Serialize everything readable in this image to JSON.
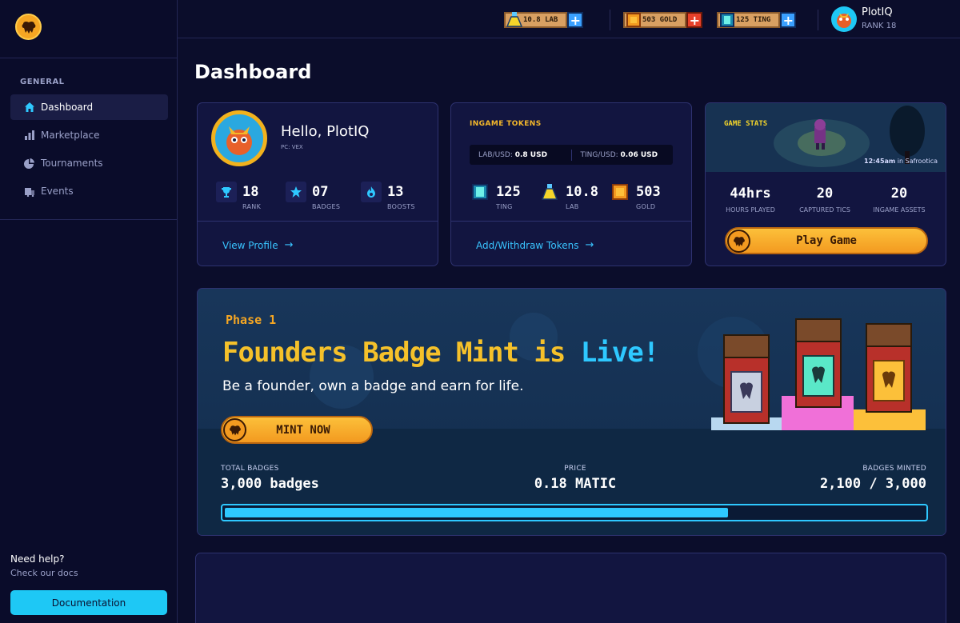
{
  "sidebar": {
    "section_title": "GENERAL",
    "items": [
      {
        "label": "Dashboard",
        "icon": "home-icon",
        "active": true
      },
      {
        "label": "Marketplace",
        "icon": "bar-chart-icon",
        "active": false
      },
      {
        "label": "Tournaments",
        "icon": "pie-chart-icon",
        "active": false
      },
      {
        "label": "Events",
        "icon": "event-icon",
        "active": false
      }
    ],
    "help_title": "Need help?",
    "help_sub": "Check our docs",
    "doc_button": "Documentation"
  },
  "topbar": {
    "tokens": [
      {
        "label": "10.8 LAB",
        "icon": "potion-icon",
        "plus_color": "#3aa0ff"
      },
      {
        "label": "503 GOLD",
        "icon": "gold-coin-icon",
        "plus_color": "#e8402a"
      },
      {
        "label": "125 TING",
        "icon": "gem-icon",
        "plus_color": "#3aa0ff"
      }
    ],
    "user_name": "PlotIQ",
    "user_rank": "RANK 18"
  },
  "page_title": "Dashboard",
  "profile": {
    "greeting": "Hello, PlotIQ",
    "pc": "PC: VEX",
    "stats": [
      {
        "value": "18",
        "label": "RANK",
        "icon": "trophy-icon"
      },
      {
        "value": "07",
        "label": "BADGES",
        "icon": "star-icon"
      },
      {
        "value": "13",
        "label": "BOOSTS",
        "icon": "flame-icon"
      }
    ],
    "link": "View Profile"
  },
  "tokens": {
    "title": "INGAME TOKENS",
    "rates": [
      {
        "label": "LAB/USD:",
        "value": "0.8 USD"
      },
      {
        "label": "TING/USD:",
        "value": "0.06 USD"
      }
    ],
    "stats": [
      {
        "value": "125",
        "label": "TING",
        "icon": "gem-icon"
      },
      {
        "value": "10.8",
        "label": "LAB",
        "icon": "potion-icon"
      },
      {
        "value": "503",
        "label": "GOLD",
        "icon": "gold-coin-icon"
      }
    ],
    "link": "Add/Withdraw Tokens"
  },
  "game_stats": {
    "title": "GAME STATS",
    "time": "12:45am",
    "location": "in Safrootica",
    "stats": [
      {
        "value": "44hrs",
        "label": "HOURS PLAYED"
      },
      {
        "value": "20",
        "label": "CAPTURED TICS"
      },
      {
        "value": "20",
        "label": "INGAME ASSETS"
      }
    ],
    "play_button": "Play Game"
  },
  "banner": {
    "phase": "Phase 1",
    "title_main": "Founders Badge Mint is ",
    "title_highlight": "Live!",
    "subtitle": "Be a founder, own a badge and earn for life.",
    "mint_button": "MINT NOW",
    "total_label": "TOTAL BADGES",
    "total_value": "3,000 badges",
    "price_label": "PRICE",
    "price_value": "0.18 MATIC",
    "minted_label": "BADGES MINTED",
    "minted_value": "2,100 / 3,000",
    "progress_fraction": 0.72
  }
}
